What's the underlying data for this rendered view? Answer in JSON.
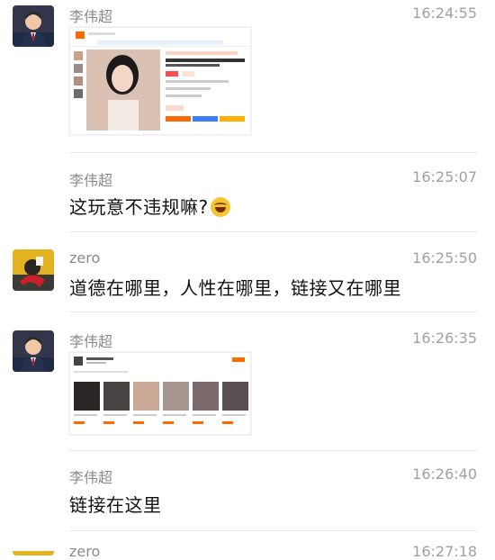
{
  "messages": [
    {
      "name": "李伟超",
      "time": "16:24:55",
      "type": "image"
    },
    {
      "name": "李伟超",
      "time": "16:25:07",
      "text": "这玩意不违规嘛?"
    },
    {
      "name": "zero",
      "time": "16:25:50",
      "text": "道德在哪里，人性在哪里，链接又在哪里"
    },
    {
      "name": "李伟超",
      "time": "16:26:35",
      "type": "image"
    },
    {
      "name": "李伟超",
      "time": "16:26:40",
      "text": "链接在这里"
    },
    {
      "name": "zero",
      "time": "16:27:18"
    }
  ],
  "colors": {
    "name": "#8a8a8a",
    "time": "#a0a0a0",
    "divider": "#e6e6e6",
    "accent": "#ff6a00",
    "link": "#3b7cff"
  },
  "icons": {
    "reaction_emoji": "laughing-tears-emoji",
    "avatar_1": "man-in-suit-avatar",
    "avatar_2": "person-with-red-hat-avatar"
  }
}
